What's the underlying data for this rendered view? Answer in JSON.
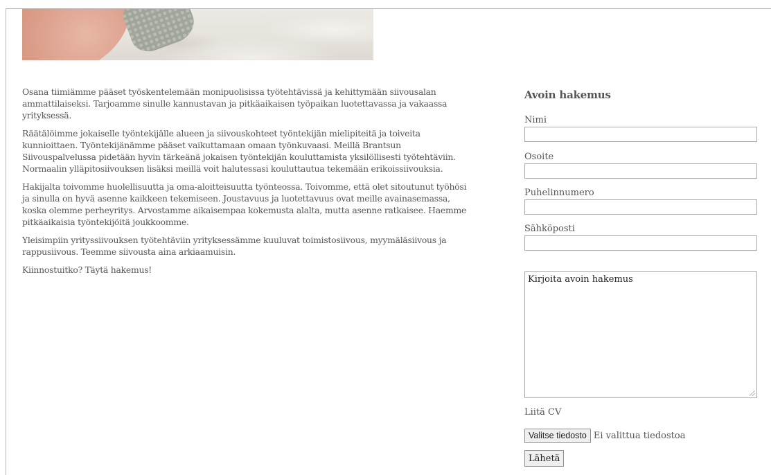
{
  "main": {
    "paragraphs": [
      "Osana tiimiämme pääset työskentelemään monipuolisissa työtehtävissä ja kehittymään siivousalan ammattilaiseksi. Tarjoamme sinulle kannustavan ja pitkäaikaisen työpaikan luotettavassa ja vakaassa yrityksessä.",
      "Räätälöimme jokaiselle työntekijälle alueen ja siivouskohteet työntekijän mielipiteitä ja toiveita kunnioittaen. Työntekijänämme pääset vaikuttamaan omaan työnkuvaasi. Meillä Brantsun Siivouspalvelussa pidetään hyvin tärkeänä jokaisen työntekijän kouluttamista yksilöllisesti työtehtäviin. Normaalin ylläpitosiivouksen lisäksi meillä voit halutessasi kouluttautua tekemään erikoissiivouksia.",
      "Hakijalta toivomme huolellisuutta ja oma-aloitteisuutta työnteossa. Toivomme, että olet sitoutunut työhösi ja sinulla on hyvä asenne kaikkeen tekemiseen. Joustavuus ja luotettavuus ovat meille avainasemassa, koska olemme perheyritys. Arvostamme aikaisempaa kokemusta alalta, mutta asenne ratkaisee. Haemme pitkäaikaisia työntekijöitä joukkoomme.",
      "Yleisimpiin yrityssiivouksen työtehtäviin yrityksessämme kuuluvat toimistosiivous, myymäläsiivous ja rappusiivous. Teemme siivousta aina arkiaamuisin.",
      "Kiinnostuitko? Täytä hakemus!"
    ]
  },
  "form": {
    "title": "Avoin hakemus",
    "name_label": "Nimi",
    "name_value": "",
    "address_label": "Osoite",
    "address_value": "",
    "phone_label": "Puhelinnumero",
    "phone_value": "",
    "email_label": "Sähköposti",
    "email_value": "",
    "application_text": "Kirjoita avoin hakemus",
    "cv_label": "Liitä CV",
    "file_button_label": "Valitse tiedosto",
    "file_status": "Ei valittua tiedostoa",
    "submit_label": "Lähetä"
  },
  "colors": {
    "text": "#555555",
    "border": "#a9a9a9",
    "button_bg": "#efefef"
  }
}
